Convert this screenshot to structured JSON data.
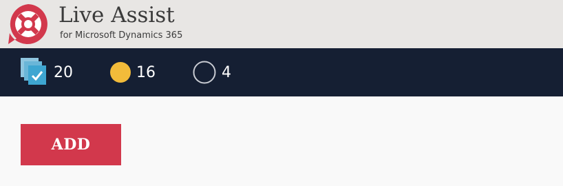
{
  "brand": {
    "title": "Live Assist",
    "subtitle": "for Microsoft Dynamics 365",
    "logo_icon": "lifebuoy-icon"
  },
  "status": [
    {
      "icon": "chats-stack-icon",
      "count": "20"
    },
    {
      "icon": "busy-dot-icon",
      "count": "16",
      "color": "#f2bb3a"
    },
    {
      "icon": "offline-circle-icon",
      "count": "4"
    }
  ],
  "actions": {
    "add_label": "ADD"
  },
  "colors": {
    "header_bg": "#e8e6e4",
    "statusbar_bg": "#151f33",
    "accent": "#d2384c"
  }
}
